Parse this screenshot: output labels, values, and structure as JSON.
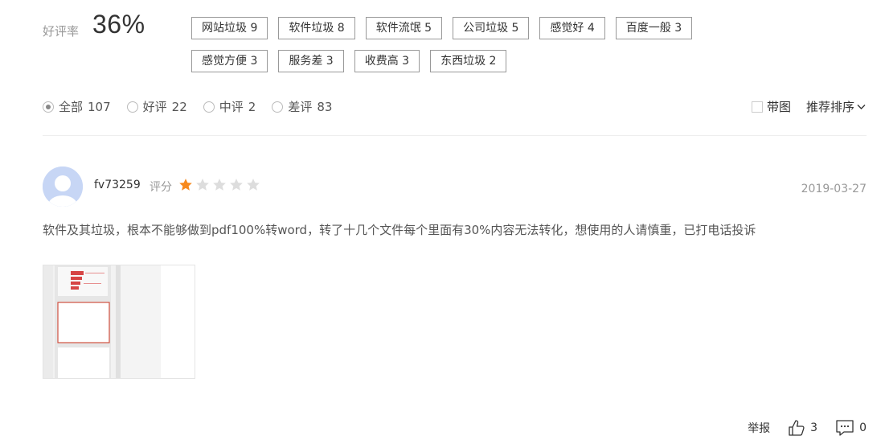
{
  "summary": {
    "label": "好评率",
    "value": "36%"
  },
  "tags": [
    "网站垃圾 9",
    "软件垃圾 8",
    "软件流氓 5",
    "公司垃圾 5",
    "感觉好 4",
    "百度一般 3",
    "感觉方便 3",
    "服务差 3",
    "收费高 3",
    "东西垃圾 2"
  ],
  "filters": [
    {
      "label": "全部",
      "count": "107",
      "selected": true
    },
    {
      "label": "好评",
      "count": "22",
      "selected": false
    },
    {
      "label": "中评",
      "count": "2",
      "selected": false
    },
    {
      "label": "差评",
      "count": "83",
      "selected": false
    }
  ],
  "controls": {
    "with_pic": "带图",
    "sort": "推荐排序"
  },
  "review": {
    "username": "fv73259",
    "score_label": "评分",
    "rating": 1,
    "max_rating": 5,
    "date": "2019-03-27",
    "text": "软件及其垃圾，根本不能够做到pdf100%转word，转了十几个文件每个里面有30%内容无法转化，想使用的人请慎重，已打电话投诉"
  },
  "actions": {
    "report": "举报",
    "likes": "3",
    "comments": "0"
  },
  "colors": {
    "star_on": "#f7891d",
    "star_off": "#dddddd",
    "avatar": "#c7d6f5"
  },
  "icons": [
    "thumbs-up-icon",
    "comment-icon",
    "star-icon",
    "chevron-down-icon",
    "user-avatar-icon"
  ]
}
